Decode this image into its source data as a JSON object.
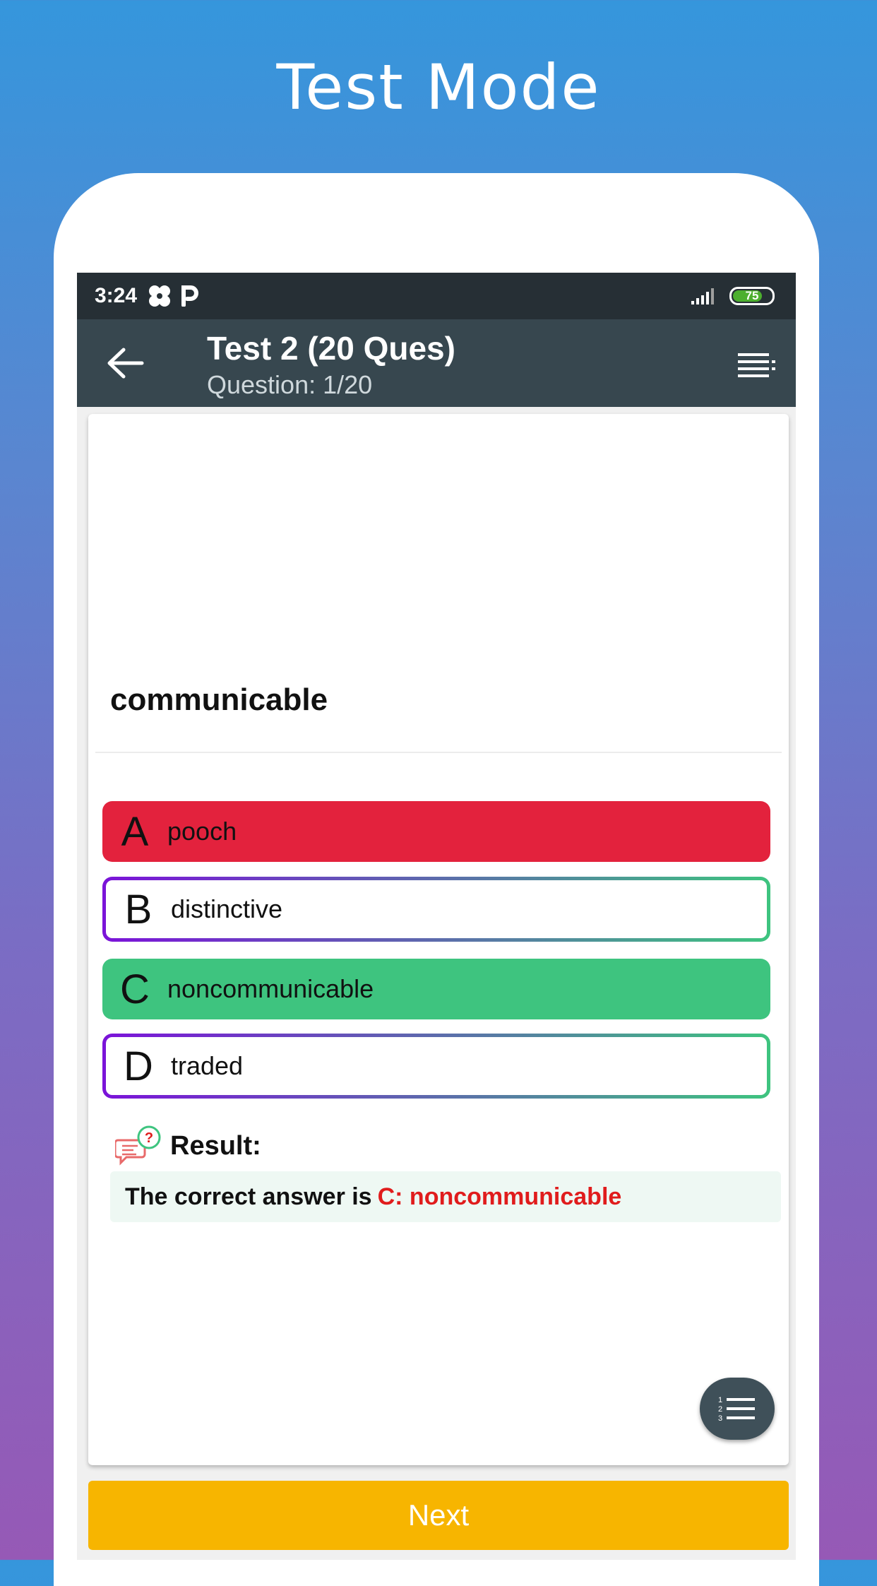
{
  "promo": {
    "title": "Test Mode"
  },
  "statusbar": {
    "time": "3:24",
    "battery": "75"
  },
  "appbar": {
    "title": "Test 2 (20 Ques)",
    "subtitle": "Question: 1/20"
  },
  "question": {
    "text": "communicable"
  },
  "options": [
    {
      "letter": "A",
      "text": "pooch",
      "state": "wrong"
    },
    {
      "letter": "B",
      "text": "distinctive",
      "state": "neutral"
    },
    {
      "letter": "C",
      "text": "noncommunicable",
      "state": "correct"
    },
    {
      "letter": "D",
      "text": "traded",
      "state": "neutral"
    }
  ],
  "result": {
    "label": "Result:",
    "prefix": "The correct answer is",
    "answer": "C: noncommunicable"
  },
  "next_label": "Next",
  "colors": {
    "wrong": "#e3223d",
    "correct": "#3ec47f",
    "accent": "#f7b500",
    "appbar": "#37474f"
  }
}
